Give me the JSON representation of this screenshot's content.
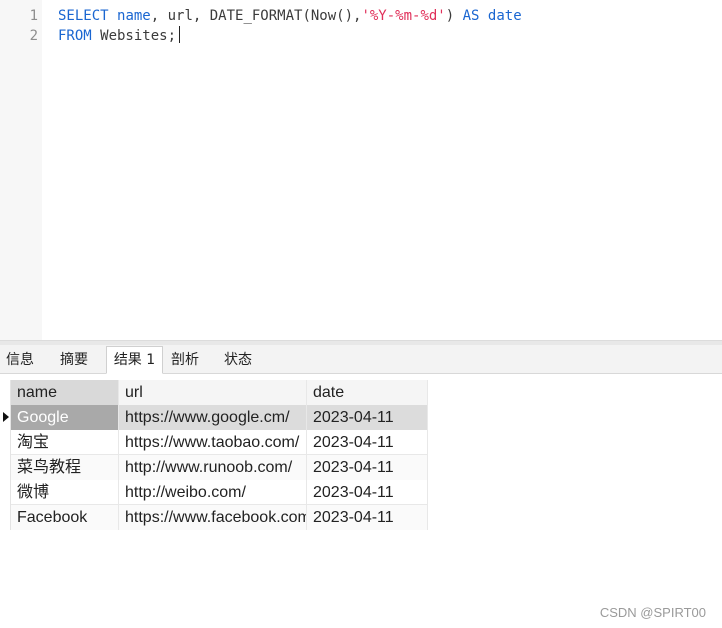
{
  "editor": {
    "line_numbers": [
      "1",
      "2"
    ],
    "line1": {
      "kw_select": "SELECT",
      "name": "name",
      "sep1": ", url, DATE_FORMAT(Now(),",
      "format": "'%Y-%m-%d'",
      "sep2": ") ",
      "kw_as": "AS",
      "date": "date"
    },
    "line2": {
      "kw_from": "FROM",
      "rest": " Websites;"
    }
  },
  "tabs": [
    {
      "label": "信息"
    },
    {
      "label": "摘要"
    },
    {
      "label": "结果 1"
    },
    {
      "label": "剖析"
    },
    {
      "label": "状态"
    }
  ],
  "active_tab": "结果 1",
  "grid": {
    "columns": [
      "name",
      "url",
      "date"
    ],
    "rows": [
      {
        "name": "Google",
        "url": "https://www.google.cm/",
        "date": "2023-04-11"
      },
      {
        "name": "淘宝",
        "url": "https://www.taobao.com/",
        "date": "2023-04-11"
      },
      {
        "name": "菜鸟教程",
        "url": "http://www.runoob.com/",
        "date": "2023-04-11"
      },
      {
        "name": "微博",
        "url": "http://weibo.com/",
        "date": "2023-04-11"
      },
      {
        "name": "Facebook",
        "url": "https://www.facebook.com/",
        "date": "2023-04-11"
      }
    ],
    "selected_row": 0
  },
  "watermark": "CSDN @SPIRT00"
}
